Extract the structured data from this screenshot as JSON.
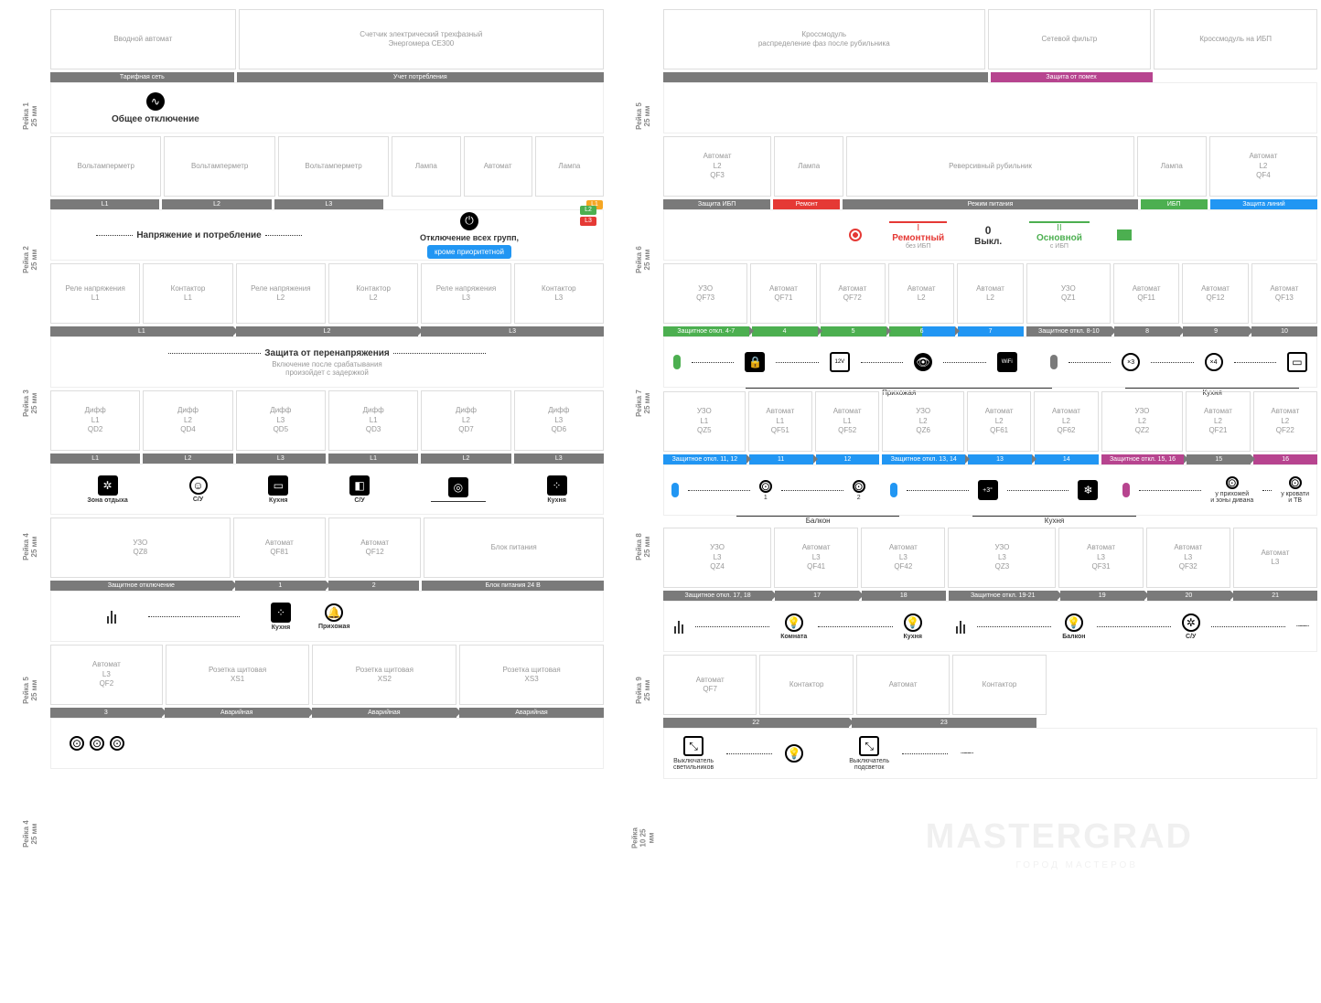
{
  "watermark": "MASTERGRAD",
  "watermark2": "ГОРОД МАСТЕРОВ",
  "rails": {
    "l1": "Рейка 1\n25 мм",
    "l2": "Рейка 2\n25 мм",
    "l3": "Рейка 3\n25 мм",
    "l4": "Рейка 4\n25 мм",
    "l5": "Рейка 5\n25 мм",
    "l6": "Рейка 4\n25 мм",
    "r1": "Рейка 5\n25 мм",
    "r2": "Рейка 6\n25 мм",
    "r3": "Рейка 7\n25 мм",
    "r4": "Рейка 8\n25 мм",
    "r5": "Рейка 9\n25 мм",
    "r6": "Рейка 10\n25 мм"
  },
  "L1": {
    "b1": "Вводной автомат",
    "b2": "Счетчик электрический трехфазный\nЭнергомера CE300",
    "t1": "Тарифная сеть",
    "t2": "Учет потребления",
    "info": "Общее отключение"
  },
  "L2": {
    "b1": "Вольтамперметр",
    "b2": "Вольтамперметр",
    "b3": "Вольтамперметр",
    "b4": "Лампа",
    "b5": "Автомат",
    "b6": "Лампа",
    "t1": "L1",
    "t2": "L2",
    "t3": "L3",
    "info1": "Напряжение и потребление",
    "info2": "Отключение всех групп,",
    "btn": "кроме приоритетной",
    "p1": "L1",
    "p2": "L2",
    "p3": "L3"
  },
  "L3": {
    "b1": "Реле напряжения\nL1",
    "b2": "Контактор\nL1",
    "b3": "Реле напряжения\nL2",
    "b4": "Контактор\nL2",
    "b5": "Реле напряжения\nL3",
    "b6": "Контактор\nL3",
    "t1": "L1",
    "t2": "L2",
    "t3": "L3",
    "info": "Защита от перенапряжения",
    "info2": "Включение после срабатывания\nпроизойдет с задержкой"
  },
  "L4": {
    "b1": "Дифф\nL1\nQD2",
    "b2": "Дифф\nL2\nQD4",
    "b3": "Дифф\nL3\nQD5",
    "b4": "Дифф\nL1\nQD3",
    "b5": "Дифф\nL2\nQD7",
    "b6": "Дифф\nL3\nQD6",
    "t1": "L1",
    "t2": "L2",
    "t3": "L3",
    "t4": "L1",
    "t5": "L2",
    "t6": "L3",
    "g1": "Зона отдыха",
    "g2": "С/У",
    "g3": "Кухня",
    "g4": "С/У",
    "g5": "",
    "g6": "Кухня"
  },
  "L5": {
    "b1": "УЗО\nQZ8",
    "b2": "Автомат\nQF81",
    "b3": "Автомат\nQF12",
    "b4": "Блок питания",
    "t1": "Защитное отключение",
    "t2": "1",
    "t3": "2",
    "t4": "Блок питания 24 В",
    "g1": "Кухня",
    "g2": "Прихожая"
  },
  "L6": {
    "b1": "Автомат\nL3\nQF2",
    "b2": "Розетка щитовая\nXS1",
    "b3": "Розетка щитовая\nXS2",
    "b4": "Розетка щитовая\nXS3",
    "t1": "3",
    "t2": "Аварийная",
    "t3": "Аварийная",
    "t4": "Аварийная"
  },
  "R1": {
    "b1": "Кроссмодуль\nраспределение фаз после рубильника",
    "b2": "Сетевой фильтр",
    "b3": "Кроссмодуль\nна ИБП",
    "t2": "Защита от помех"
  },
  "R2": {
    "b1": "Автомат\nL2\nQF3",
    "b2": "Лампа",
    "b3": "Реверсивный рубильник",
    "b4": "Лампа",
    "b5": "Автомат\nL2\nQF4",
    "t1": "Защита ИБП",
    "t2": "Ремонт",
    "t3": "Режим питания",
    "t4": "ИБП",
    "t5": "Защита линий",
    "m1": "I",
    "m2": "0",
    "m3": "II",
    "m1b": "Ремонтный",
    "m2b": "Выкл.",
    "m3b": "Основной",
    "m1c": "без ИБП",
    "m3c": "с ИБП"
  },
  "R3": {
    "b1": "УЗО\nQF73",
    "b2": "Автомат\nQF71",
    "b3": "Автомат\nQF72",
    "b4": "Автомат\nL2",
    "b5": "Автомат\nL2",
    "b6": "УЗО\nQZ1",
    "b7": "Автомат\nQF11",
    "b8": "Автомат\nQF12",
    "b9": "Автомат\nQF13",
    "t1": "Защитное откл. 4-7",
    "t2": "4",
    "t3": "5",
    "t4": "6",
    "t5": "7",
    "t6": "Защитное откл. 8-10",
    "t7": "8",
    "t8": "9",
    "t9": "10",
    "zone1": "Прихожая",
    "zone2": "Кухня"
  },
  "R4": {
    "b1": "УЗО\nL1\nQZ5",
    "b2": "Автомат\nL1\nQF51",
    "b3": "Автомат\nL1\nQF52",
    "b4": "УЗО\nL2\nQZ6",
    "b5": "Автомат\nL2\nQF61",
    "b6": "Автомат\nL2\nQF62",
    "b7": "УЗО\nL2\nQZ2",
    "b8": "Автомат\nL2\nQF21",
    "b9": "Автомат\nL2\nQF22",
    "t1": "Защитное откл. 11, 12",
    "t2": "11",
    "t3": "12",
    "t4": "Защитное откл. 13, 14",
    "t5": "13",
    "t6": "14",
    "t7": "Защитное откл. 15, 16",
    "t8": "15",
    "t9": "16",
    "z1": "Балкон",
    "z2": "Кухня",
    "g1": "у прихожей\nи зоны дивана",
    "g2": "у кровати\nи ТВ",
    "n1": "1",
    "n2": "2"
  },
  "R5": {
    "b1": "УЗО\nL3\nQZ4",
    "b2": "Автомат\nL3\nQF41",
    "b3": "Автомат\nL3\nQF42",
    "b4": "УЗО\nL3\nQZ3",
    "b5": "Автомат\nL3\nQF31",
    "b6": "Автомат\nL3\nQF32",
    "b7": "Автомат\nL3",
    "t1": "Защитное откл. 17, 18",
    "t2": "17",
    "t3": "18",
    "t4": "Защитное откл. 19-21",
    "t5": "19",
    "t6": "20",
    "t7": "21",
    "g1": "Комната",
    "g2": "Кухня",
    "g3": "Балкон",
    "g4": "С/У"
  },
  "R6": {
    "b1": "Автомат\nQF7",
    "b2": "Контактор",
    "b3": "Автомат",
    "b4": "Контактор",
    "t1": "22",
    "t2": "23",
    "g1": "Выключатель\nсветильников",
    "g2": "Выключатель\nподсветок"
  }
}
